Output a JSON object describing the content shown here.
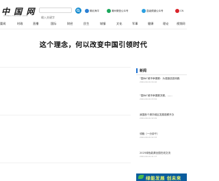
{
  "header": {
    "logo": "中 国 网",
    "logo_url": "CHINA.HUASHE.COM",
    "search_placeholder": "输入关键字",
    "links": [
      {
        "label": "微北海平",
        "color": "#2b7fd3"
      },
      {
        "label": "潮州微信公众号",
        "color": "#1aa75b"
      },
      {
        "label": "县级频道公众号",
        "color": "#2b9fe0"
      },
      {
        "label": "CN",
        "color": "#d9242b"
      }
    ]
  },
  "nav": {
    "items": [
      "要闻",
      "时政",
      "直播",
      "国际",
      "财经",
      "民生",
      "城镇",
      "文化",
      "军事",
      "健康",
      "理论",
      "视频网"
    ]
  },
  "headline": "这个理念，何以改变中国引领时代",
  "news": {
    "title": "新闻",
    "items": [
      {
        "text": "“国BA”城市争霸赛：为强镇选拔而跑",
        "meta": "2024-09-01 04:16"
      },
      {
        "text": "“国BA”城市争霸赛决赛，……",
        "meta": "2024-09-01 03:54"
      },
      {
        "text": "我国首个清华城区发展观察开办",
        "meta": "2024-09-01 02:49"
      },
      {
        "text": "领跑（一分钟干）",
        "meta": "2024-09-01 02:33"
      },
      {
        "text": "2025绿色能源全国在线交流",
        "meta": "2024-09-01 01:17"
      }
    ]
  },
  "banner": {
    "text": "绿能发展 创未来"
  }
}
